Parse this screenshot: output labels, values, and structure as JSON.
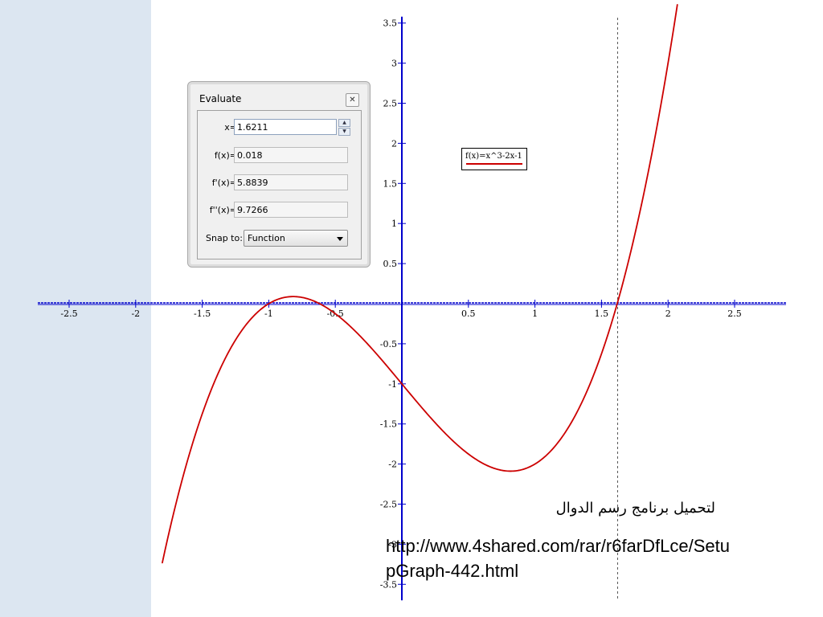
{
  "chart_data": {
    "type": "line",
    "title": "",
    "xlabel": "",
    "ylabel": "",
    "xlim": [
      -2.75,
      2.85
    ],
    "ylim": [
      -3.5,
      3.5
    ],
    "x_ticks": [
      -2.5,
      -2,
      -1.5,
      -1,
      -0.5,
      0.5,
      1,
      1.5,
      2,
      2.5
    ],
    "x_tick_labels": [
      "-2.5",
      "-2",
      "-1.5",
      "-1",
      "-0.5",
      "0.5",
      "1",
      "1.5",
      "2",
      "2.5"
    ],
    "y_ticks": [
      3.5,
      3,
      2.5,
      2,
      1.5,
      1,
      0.5,
      -0.5,
      -1,
      -1.5,
      -2,
      -2.5,
      -3,
      -3.5
    ],
    "y_tick_labels": [
      "3.5",
      "3",
      "2.5",
      "2",
      "1.5",
      "1",
      "0.5",
      "-0.5",
      "-1",
      "-1.5",
      "-2",
      "-2.5",
      "-3",
      "-3.5"
    ],
    "series": [
      {
        "name": "f(x)=x^3-2x-1",
        "color": "#cc0000",
        "x": [
          -1.8,
          -1.6,
          -1.4,
          -1.2,
          -1.0,
          -0.82,
          -0.6,
          -0.4,
          -0.2,
          0,
          0.2,
          0.4,
          0.6,
          0.82,
          1.0,
          1.2,
          1.4,
          1.6,
          1.8,
          2.0,
          2.07
        ],
        "y": [
          -3.232,
          -1.896,
          -0.944,
          -0.328,
          0.0,
          0.089,
          -0.016,
          -0.264,
          -0.608,
          -1.0,
          -1.392,
          -1.736,
          -1.984,
          -2.089,
          -2.0,
          -1.672,
          -1.056,
          -0.104,
          1.232,
          3.0,
          3.73
        ]
      }
    ],
    "marker_x": 1.6211,
    "legend_position": "top-right"
  },
  "dialog": {
    "title": "Evaluate",
    "close_icon": "close-icon",
    "x_label": "x=",
    "x_value": "1.6211",
    "fx_label": "f(x)=",
    "fx_value": "0.018",
    "fpx_label": "f'(x)=",
    "fpx_value": "5.8839",
    "fppx_label": "f''(x)=",
    "fppx_value": "9.7266",
    "snap_label": "Snap to:",
    "snap_value": "Function"
  },
  "legend": {
    "text": "f(x)=x^3-2x-1",
    "color": "#cc0000"
  },
  "caption": {
    "arabic": "لتحميل برنامج رسم الدوال",
    "url_line1": "http://www.4shared.com/rar/r6farDfLce/Setu",
    "url_line2": "pGraph-442.html"
  },
  "colors": {
    "axis": "#0000cc",
    "curve": "#cc0000",
    "side_strip": "#dce6f1"
  }
}
